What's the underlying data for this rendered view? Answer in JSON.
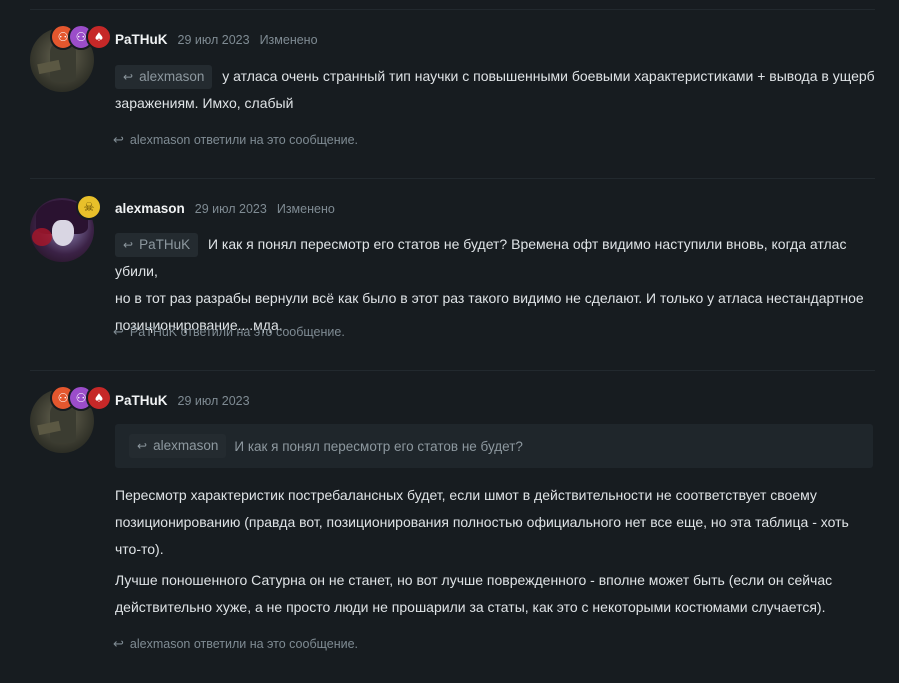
{
  "posts": [
    {
      "username": "PaTHuK",
      "date": "29 июл 2023",
      "edited": "Изменено",
      "badges": [
        "orange",
        "purple",
        "red"
      ],
      "quote_user": "alexmason",
      "text_line1": "у атласа очень странный тип научки с повышенными боевыми характеристиками + вывода в ущерб",
      "text_line2": "заражениям. Имхо, слабый",
      "replied": "alexmason ответили на это сообщение."
    },
    {
      "username": "alexmason",
      "date": "29 июл 2023",
      "edited": "Изменено",
      "badges": [
        "yellow"
      ],
      "quote_user": "PaTHuK",
      "text_line1": "И как я понял пересмотр его статов не будет? Времена офт видимо наступили вновь, когда атлас убили,",
      "text_line2": "но в тот раз разрабы вернули всё как было в этот раз такого видимо не сделают. И только у атласа нестандартное",
      "text_line3": "позиционирование....мда.",
      "replied": "PaTHuK ответили на это сообщение."
    },
    {
      "username": "PaTHuK",
      "date": "29 июл 2023",
      "badges": [
        "orange",
        "purple",
        "red"
      ],
      "quote_user": "alexmason",
      "quote_text": "И как я понял пересмотр его статов не будет?",
      "para1_line1": "Пересмотр характеристик постребалансных будет, если шмот в действительности не соответствует своему",
      "para1_line2": "позиционированию (правда вот, позиционирования полностью официального нет все еще, но эта таблица - хоть",
      "para1_line3": "что-то).",
      "para2_line1": "Лучше поношенного Сатурна он не станет, но вот лучше поврежденного - вполне может быть (если он сейчас",
      "para2_line2": "действительно хуже, а не просто люди не прошарили за статы, как это с некоторыми костюмами случается).",
      "replied": "alexmason ответили на это сообщение."
    }
  ],
  "icons": {
    "reply": "reply-arrow-icon",
    "badge_orange": "user-icon",
    "badge_purple": "user-icon",
    "badge_red": "spade-icon",
    "badge_yellow": "skull-icon"
  },
  "colors": {
    "background": "#171c20",
    "quote_bg": "#242b30",
    "muted": "#7f8b93"
  }
}
